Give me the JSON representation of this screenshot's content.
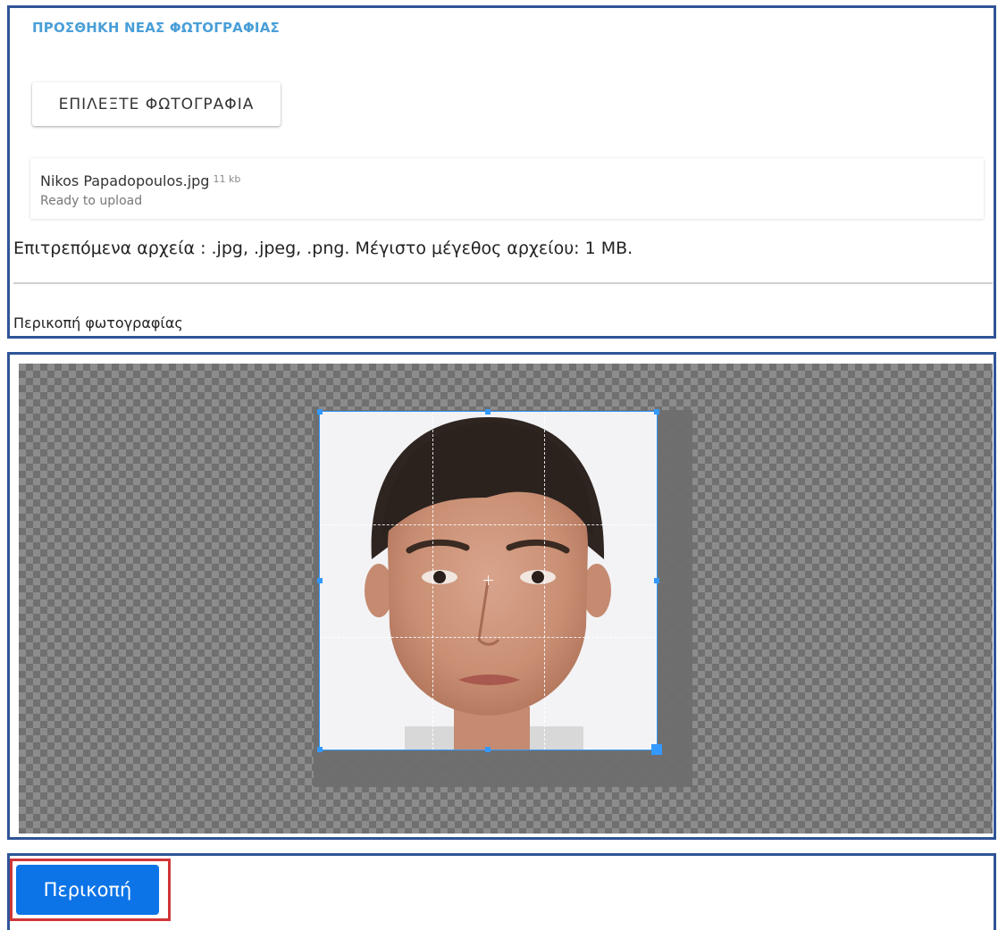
{
  "upload": {
    "title": "ΠΡΟΣΘΗΚΗ ΝΕΑΣ ΦΩΤΟΓΡΑΦΙΑΣ",
    "choose_button": "ΕΠΙΛΕΞΤΕ ΦΩΤΟΓΡΑΦΙΑ",
    "file": {
      "name": "Nikos Papadopoulos.jpg",
      "size": "11 kb",
      "status": "Ready to upload"
    },
    "allowed_info": "Επιτρεπόμενα αρχεία : .jpg, .jpeg, .png. Μέγιστο μέγεθος αρχείου: 1 MB.",
    "crop_section_label": "Περικοπή φωτογραφίας"
  },
  "cropper": {
    "accent_color": "#3399ff",
    "icons": [
      "crop-center-icon",
      "crop-handle"
    ]
  },
  "actions": {
    "crop_button": "Περικοπή",
    "crop_button_color": "#0d74e7",
    "highlight_color": "#d03538"
  },
  "colors": {
    "panel_border": "#2f5597",
    "title_blue": "#4a9fd8"
  }
}
